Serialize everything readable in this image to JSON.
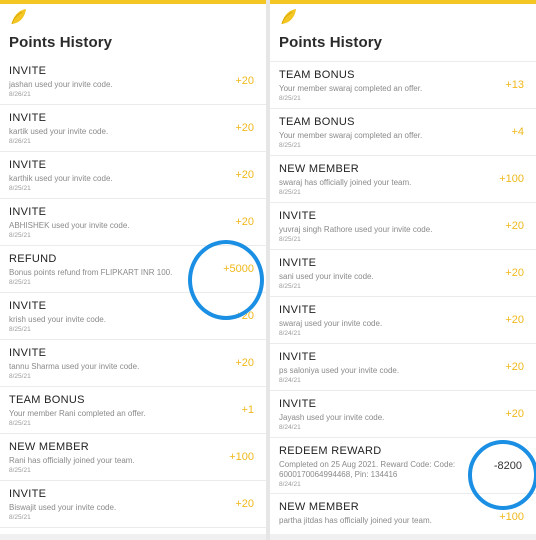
{
  "left": {
    "title": "Points History",
    "items": [
      {
        "title": "INVITE",
        "desc": "jashan used your invite code.",
        "date": "8/26/21",
        "points": "+20"
      },
      {
        "title": "INVITE",
        "desc": "kartik used your invite code.",
        "date": "8/26/21",
        "points": "+20"
      },
      {
        "title": "INVITE",
        "desc": "karthik used your invite code.",
        "date": "8/25/21",
        "points": "+20"
      },
      {
        "title": "INVITE",
        "desc": "ABHISHEK used your invite code.",
        "date": "8/25/21",
        "points": "+20"
      },
      {
        "title": "REFUND",
        "desc": "Bonus points refund from FLIPKART INR 100.",
        "date": "8/25/21",
        "points": "+5000"
      },
      {
        "title": "INVITE",
        "desc": "krish used your invite code.",
        "date": "8/25/21",
        "points": "+20"
      },
      {
        "title": "INVITE",
        "desc": "tannu Sharma used your invite code.",
        "date": "8/25/21",
        "points": "+20"
      },
      {
        "title": "TEAM BONUS",
        "desc": "Your member Rani completed an offer.",
        "date": "8/25/21",
        "points": "+1"
      },
      {
        "title": "NEW MEMBER",
        "desc": "Rani has officially joined your team.",
        "date": "8/25/21",
        "points": "+100"
      },
      {
        "title": "INVITE",
        "desc": "Biswajit used your invite code.",
        "date": "8/25/21",
        "points": "+20"
      }
    ]
  },
  "right": {
    "title": "Points History",
    "items": [
      {
        "title": "TEAM BONUS",
        "desc": "Your member swaraj completed an offer.",
        "date": "8/25/21",
        "points": "+13"
      },
      {
        "title": "TEAM BONUS",
        "desc": "Your member swaraj completed an offer.",
        "date": "8/25/21",
        "points": "+4"
      },
      {
        "title": "NEW MEMBER",
        "desc": "swaraj has officially joined your team.",
        "date": "8/25/21",
        "points": "+100"
      },
      {
        "title": "INVITE",
        "desc": "yuvraj singh Rathore used your invite code.",
        "date": "8/25/21",
        "points": "+20"
      },
      {
        "title": "INVITE",
        "desc": "sani used your invite code.",
        "date": "8/25/21",
        "points": "+20"
      },
      {
        "title": "INVITE",
        "desc": "swaraj used your invite code.",
        "date": "8/24/21",
        "points": "+20"
      },
      {
        "title": "INVITE",
        "desc": "ps saloniya used your invite code.",
        "date": "8/24/21",
        "points": "+20"
      },
      {
        "title": "INVITE",
        "desc": "Jayash used your invite code.",
        "date": "8/24/21",
        "points": "+20"
      },
      {
        "title": "REDEEM REWARD",
        "desc": "Completed on 25 Aug 2021. Reward Code: Code: 6000170064994468, Pin: 134416",
        "date": "8/24/21",
        "points": "-8200"
      },
      {
        "title": "NEW MEMBER",
        "desc": "partha jitdas has officially joined your team.",
        "date": "",
        "points": "+100"
      }
    ]
  },
  "colors": {
    "accent": "#f0b81a",
    "annotation": "#1a8fe3"
  },
  "icons": {
    "logo": "yellow-leaf-icon"
  }
}
